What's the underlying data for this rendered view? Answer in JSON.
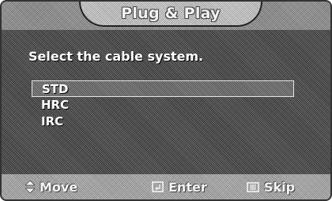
{
  "title": "Plug & Play",
  "prompt": "Select the cable system.",
  "options": [
    {
      "label": "STD",
      "selected": true
    },
    {
      "label": "HRC",
      "selected": false
    },
    {
      "label": "IRC",
      "selected": false
    }
  ],
  "footer": {
    "move": {
      "icon": "up-down-arrow-icon",
      "label": "Move"
    },
    "enter": {
      "icon": "enter-icon",
      "label": "Enter"
    },
    "skip": {
      "icon": "menu-icon",
      "label": "Skip"
    }
  },
  "colors": {
    "background": "#3c3c3c",
    "title_tab": "#b4b4b4",
    "footer": "#9a9a9a",
    "text": "#ffffff"
  }
}
